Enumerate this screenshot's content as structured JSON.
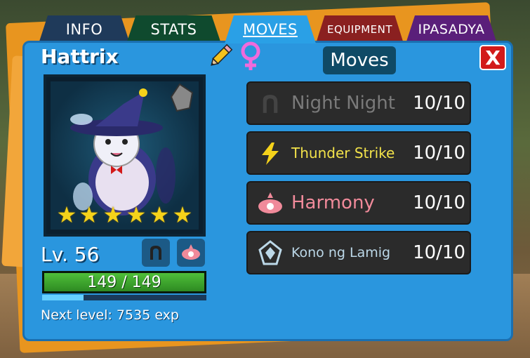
{
  "tabs": {
    "info": "INFO",
    "stats": "STATS",
    "moves": "MOVES",
    "equipment": "EQUIPMENT",
    "ipasadya": "IPASADYA"
  },
  "creature": {
    "name": "Hattrix",
    "gender_icon": "female-symbol",
    "level_label": "Lv. 56",
    "hp_text": "149 / 149",
    "hp_fraction": 1.0,
    "xp_fraction": 0.25,
    "next_level_text": "Next level: 7535 exp",
    "stars": 6,
    "star_color": "#f5d21a"
  },
  "moves_panel": {
    "title": "Moves",
    "close_label": "X",
    "moves": [
      {
        "name": "Night Night",
        "pp": "10/10",
        "color": "#7a7a7a",
        "icon": "dark-type-icon"
      },
      {
        "name": "Thunder Strike",
        "pp": "10/10",
        "color": "#f2e24a",
        "icon": "electric-type-icon"
      },
      {
        "name": "Harmony",
        "pp": "10/10",
        "color": "#f08a9a",
        "icon": "psychic-type-icon"
      },
      {
        "name": "Kono ng Lamig",
        "pp": "10/10",
        "color": "#bcd8e8",
        "icon": "ice-type-icon"
      }
    ]
  },
  "colors": {
    "panel": "#2a96de",
    "close": "#d21a1a",
    "hp": "#4fc03a"
  }
}
